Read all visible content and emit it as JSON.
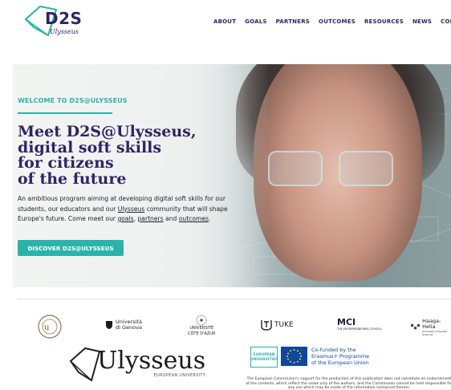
{
  "header": {
    "logo_text": "D2S",
    "logo_subtext": "Ulysseus",
    "nav": [
      "ABOUT",
      "GOALS",
      "PARTNERS",
      "OUTCOMES",
      "RESOURCES",
      "NEWS",
      "CONTAC"
    ]
  },
  "hero": {
    "eyebrow": "WELCOME TO D2S@ULYSSEUS",
    "headline_lines": [
      "Meet D2S@Ulysseus,",
      "digital soft skills",
      "for citizens",
      "of the future"
    ],
    "blurb_line1": "An ambitious program aiming at developing digital soft skills for our",
    "blurb_line2_a": "students, our educators and our ",
    "blurb_line2_link": "Ulysseus",
    "blurb_line2_b": " community that will shape",
    "blurb_line3_a": "Europe's future. Come meet our ",
    "blurb_link_goals": "goals",
    "blurb_sep": ", ",
    "blurb_link_partners": "partners",
    "blurb_and": " and ",
    "blurb_link_outcomes": "outcomes",
    "blurb_end": ".",
    "cta_label": "DISCOVER D2S@ULYSSEUS"
  },
  "partners": {
    "genova_line1": "Università",
    "genova_line2": "di Genova",
    "cote_line1": "UNIVERSITÉ",
    "cote_line2": "CÔTE D'AZUR",
    "tuke": "TUKE",
    "mci": "MCI",
    "mci_sub": "THE ENTREPRENEURIAL SCHOOL",
    "haaga": "Haaga-Helia",
    "haaga_sub": "University of Applied Sciences",
    "ulysseus": "Ulysseus",
    "ulysseus_sub": "EUROPEAN UNIVERSITY",
    "eu_universities_line1": "EUROPEAN",
    "eu_universities_line2": "UNIVERSITIES",
    "erasmus_line1": "Co-funded by the",
    "erasmus_line2": "Erasmus+ Programme",
    "erasmus_line3": "of the European Union"
  },
  "disclaimer": "The European Commission's support for the production of this publication does not constitute an endorsement of the contents, which reflect the views only of the authors, and the Commission cannot be held responsible for any use which may be made of the information contained therein.",
  "colors": {
    "brand": "#2e2466",
    "accent": "#2bb3a9",
    "eu_blue": "#0e47a1",
    "eu_yellow": "#ffd617"
  }
}
